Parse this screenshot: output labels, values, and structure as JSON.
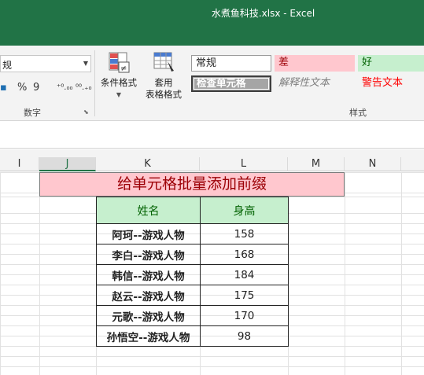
{
  "window": {
    "title": "水煮鱼科技.xlsx - Excel"
  },
  "ribbon": {
    "number_format_value": "规",
    "number_buttons": [
      "%",
      "9",
      "⁺⁰.₀₀",
      "⁰⁰.₊₀"
    ],
    "number_group_label": "数字",
    "conditional_format_label_1": "条件格式",
    "table_format_label_1": "套用",
    "table_format_label_2": "表格格式",
    "styles": {
      "normal": "常规",
      "bad": "差",
      "good": "好",
      "check_cell": "检查单元格",
      "explanatory": "解释性文本",
      "warning": "警告文本"
    },
    "styles_group_label": "样式"
  },
  "columns": [
    "I",
    "J",
    "K",
    "L",
    "M",
    "N"
  ],
  "selected_column": "J",
  "banner": "给单元格批量添加前缀",
  "table": {
    "headers": [
      "姓名",
      "身高"
    ],
    "rows": [
      [
        "阿珂--游戏人物",
        "158"
      ],
      [
        "李白--游戏人物",
        "168"
      ],
      [
        "韩信--游戏人物",
        "184"
      ],
      [
        "赵云--游戏人物",
        "175"
      ],
      [
        "元歌--游戏人物",
        "170"
      ],
      [
        "孙悟空--游戏人物",
        "98"
      ]
    ]
  },
  "colors": {
    "excel_green": "#217346",
    "bad_fill": "#ffc7ce",
    "good_fill": "#c6efce"
  }
}
